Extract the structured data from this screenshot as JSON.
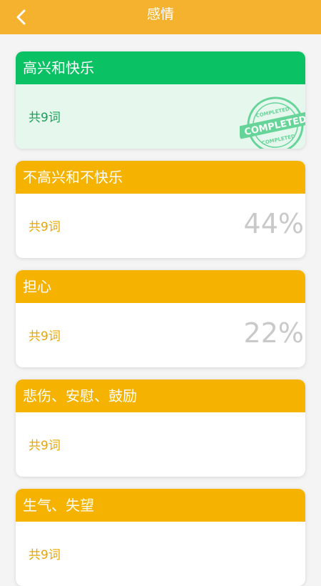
{
  "header": {
    "title": "感情",
    "back_icon": "chevron-left-icon"
  },
  "colors": {
    "header_bg": "#f5b22e",
    "completed_head": "#0ac263",
    "completed_body": "#e6f8ee",
    "completed_text": "#18a057",
    "pending_head": "#f5b300",
    "pending_text": "#e8a600",
    "percent_text": "#c9c9c9"
  },
  "cards": [
    {
      "title": "高兴和快乐",
      "count": "共9词",
      "status": "completed",
      "stamp_text": "COMPLETED",
      "percent": ""
    },
    {
      "title": "不高兴和不快乐",
      "count": "共9词",
      "status": "in_progress",
      "percent": "44%"
    },
    {
      "title": "担心",
      "count": "共9词",
      "status": "in_progress",
      "percent": "22%"
    },
    {
      "title": "悲伤、安慰、鼓励",
      "count": "共9词",
      "status": "not_started",
      "percent": ""
    },
    {
      "title": "生气、失望",
      "count": "共9词",
      "status": "not_started",
      "percent": ""
    }
  ]
}
